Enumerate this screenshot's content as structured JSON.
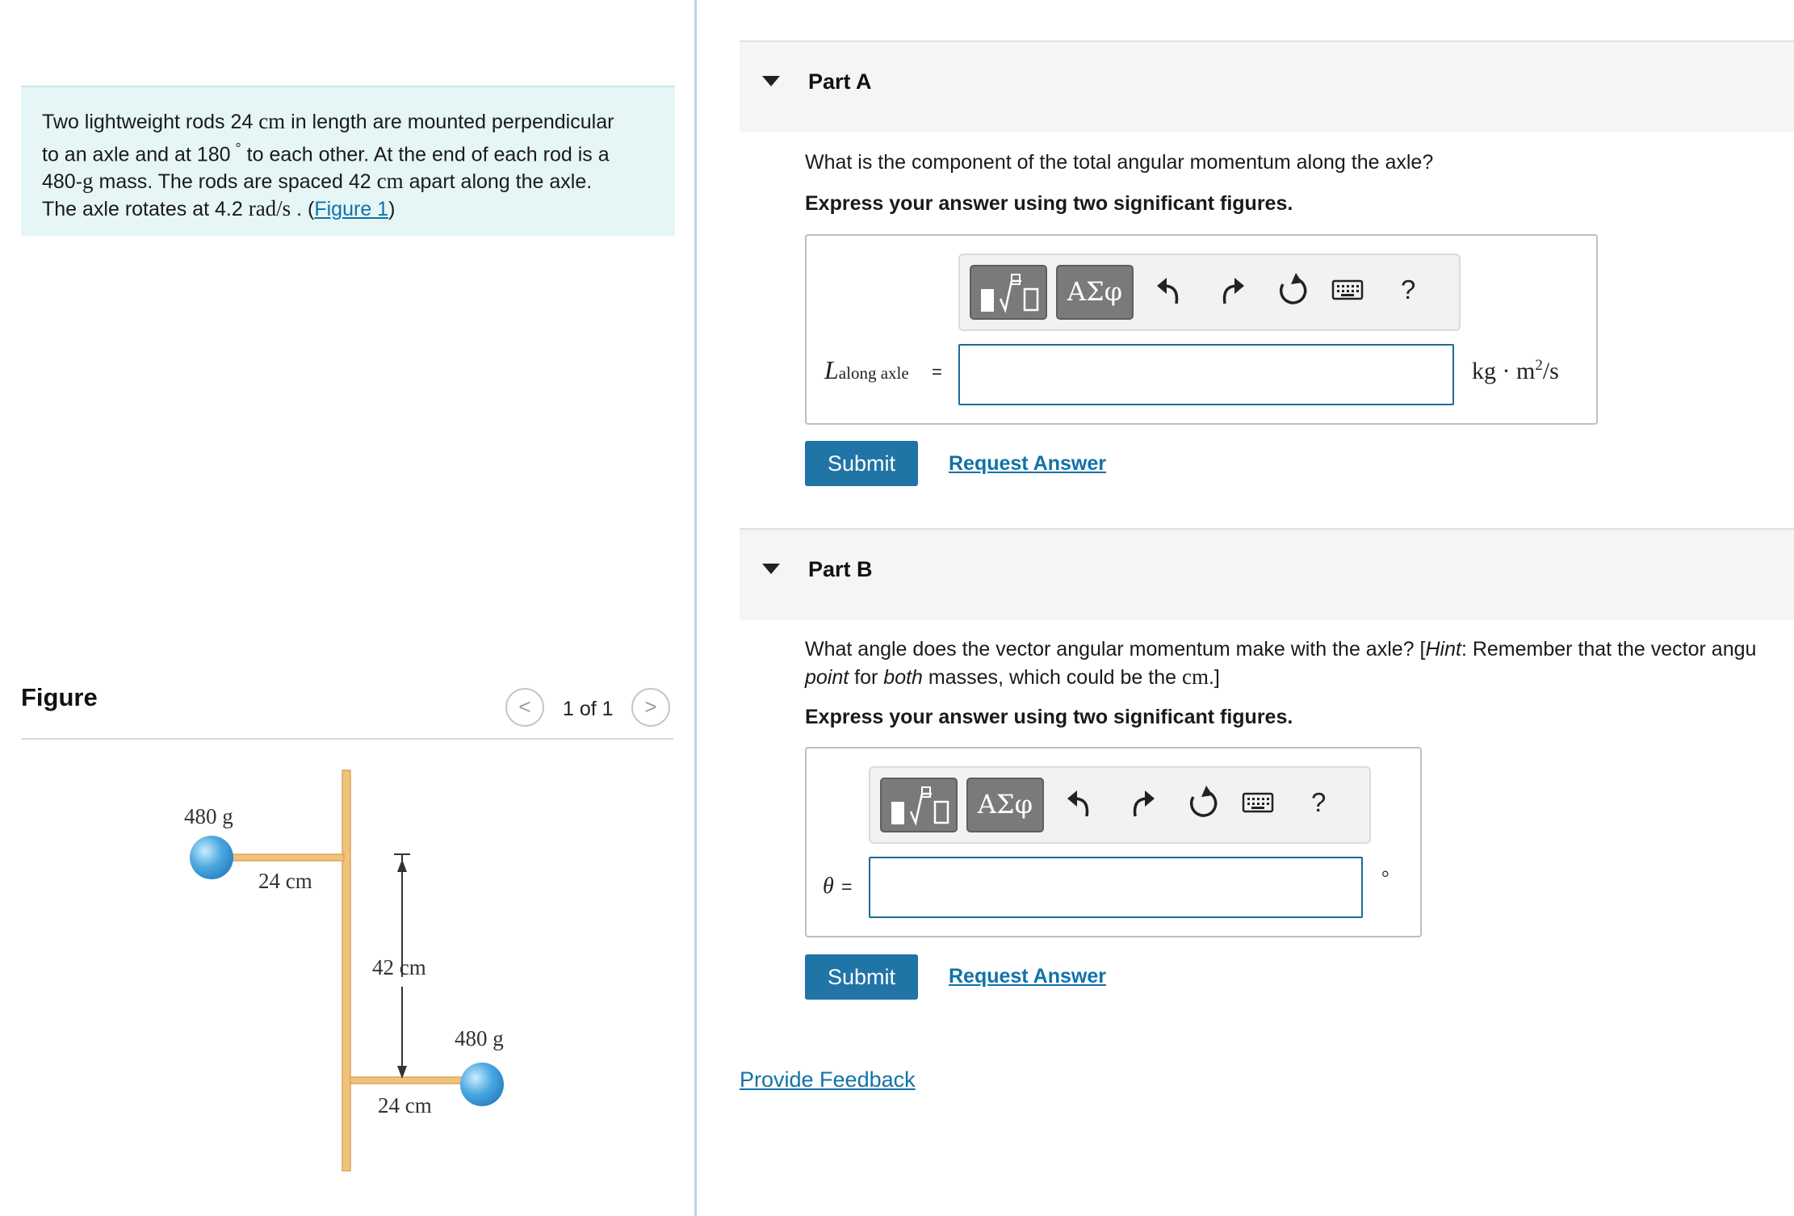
{
  "problem": {
    "t1": "Two lightweight rods 24 ",
    "cm1": "cm",
    "t2": " in length are mounted perpendicular",
    "t3": "to an axle and at 180",
    "deg": "°",
    "t4": " to each other. At the end of each rod is a",
    "t5": "480-",
    "g": "g",
    "t6": " mass. The rods are spaced 42 ",
    "cm2": "cm",
    "t7": " apart along the axle.",
    "t8": "The axle rotates at 4.2 ",
    "rads": "rad/s",
    "t9": " . (",
    "figure_link": "Figure 1",
    "t10": ")"
  },
  "figure_panel": {
    "title": "Figure",
    "counter": "1 of 1",
    "prev_glyph": "<",
    "next_glyph": ">"
  },
  "figure": {
    "top_mass": "480 g",
    "top_rod": "24 cm",
    "spacing": "42 cm",
    "bottom_mass": "480 g",
    "bottom_rod": "24 cm",
    "colors": {
      "rod": "#f0c27b",
      "rod_edge": "#d9a55a",
      "ball": "#4aa8e0",
      "ball_light": "#c9ecff"
    }
  },
  "partA": {
    "title": "Part A",
    "question": "What is the component of the total angular momentum along the axle?",
    "instruction": "Express your answer using two significant figures.",
    "var_main": "L",
    "var_sub": "along axle",
    "equals": "=",
    "unit_main": "kg · m",
    "unit_exp": "2",
    "unit_tail": "/s",
    "input_value": "",
    "submit": "Submit",
    "request": "Request Answer"
  },
  "partB": {
    "title": "Part B",
    "q1": "What angle does the vector angular momentum make with the axle? [",
    "hint": "Hint",
    "q2": ": Remember that the vector angu",
    "point": "point",
    "q3": " for ",
    "both": "both",
    "q4": " masses, which could be the ",
    "cm": "cm",
    "q5": ".]",
    "instruction": "Express your answer using two significant figures.",
    "var": "θ",
    "equals": "=",
    "unit": "°",
    "input_value": "",
    "submit": "Submit",
    "request": "Request Answer"
  },
  "toolbar": {
    "greek": "ΑΣφ",
    "help": "?",
    "icons": [
      "templates-icon",
      "greek-letters-icon",
      "undo-icon",
      "redo-icon",
      "reset-icon",
      "keyboard-icon",
      "help-icon"
    ]
  },
  "feedback": "Provide Feedback",
  "accent_color": "#1172a8"
}
